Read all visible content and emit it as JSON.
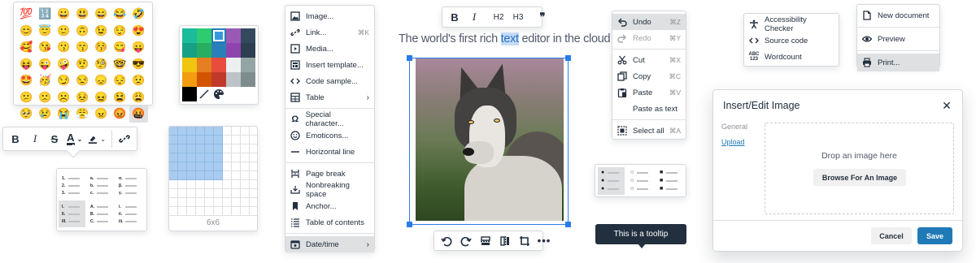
{
  "emoji_panel": {
    "items": [
      "💯",
      "🔢",
      "😀",
      "😃",
      "😄",
      "😂",
      "🤣",
      "😊",
      "😇",
      "🙂",
      "🙃",
      "😉",
      "😌",
      "😍",
      "🥰",
      "😘",
      "😗",
      "😙",
      "😚",
      "😋",
      "😛",
      "😝",
      "😜",
      "🤪",
      "🤨",
      "🧐",
      "🤓",
      "😎",
      "🤩",
      "🥳",
      "😏",
      "😒",
      "😞",
      "😔",
      "😟",
      "😕",
      "🙁",
      "☹️",
      "😣",
      "😖",
      "😫",
      "😩",
      "🥺",
      "😢",
      "😭",
      "😤",
      "😠",
      "😡",
      "🤬"
    ],
    "selected_index": 48
  },
  "color_panel": {
    "colors": [
      "#1abc9c",
      "#2ecc71",
      "#3498db",
      "#9b59b6",
      "#34495e",
      "#16a085",
      "#27ae60",
      "#2980b9",
      "#8e44ad",
      "#2c3e50",
      "#f1c40f",
      "#e67e22",
      "#e74c3c",
      "#ecf0f1",
      "#95a5a6",
      "#f39c12",
      "#d35400",
      "#c0392b",
      "#bdc3c7",
      "#7f8c8d",
      "#000000"
    ],
    "selected_index": 2,
    "tools": [
      "remove-color-icon",
      "color-picker-icon"
    ]
  },
  "format_toolbar": {
    "bold": "B",
    "italic": "I",
    "strike": "S",
    "text_color": "A",
    "highlight": "highlight-icon",
    "link": "link-icon"
  },
  "numbered_list_styles": [
    {
      "marks": [
        "1.",
        "2.",
        "3."
      ]
    },
    {
      "marks": [
        "a.",
        "b.",
        "c."
      ]
    },
    {
      "marks": [
        "α.",
        "β.",
        "γ."
      ]
    },
    {
      "marks": [
        "I.",
        "II.",
        "III."
      ]
    },
    {
      "marks": [
        "A.",
        "B.",
        "C."
      ]
    },
    {
      "marks": [
        "i.",
        "ii.",
        "iii."
      ]
    }
  ],
  "table_picker": {
    "cols_selected": 6,
    "rows_selected": 6,
    "label": "6x6"
  },
  "insert_menu": {
    "items": [
      {
        "label": "Image...",
        "icon": "image-icon",
        "shortcut": ""
      },
      {
        "label": "Link...",
        "icon": "link-icon",
        "shortcut": "⌘K"
      },
      {
        "label": "Media...",
        "icon": "media-icon",
        "shortcut": ""
      },
      {
        "label": "Insert template...",
        "icon": "template-icon",
        "shortcut": ""
      },
      {
        "label": "Code sample...",
        "icon": "code-icon",
        "shortcut": ""
      },
      {
        "label": "Table",
        "icon": "table-icon",
        "shortcut": "",
        "submenu": true
      },
      {
        "label": "Special character...",
        "icon": "omega-icon",
        "shortcut": ""
      },
      {
        "label": "Emoticons...",
        "icon": "emoticon-icon",
        "shortcut": ""
      },
      {
        "label": "Horizontal line",
        "icon": "hr-icon",
        "shortcut": ""
      },
      {
        "label": "Page break",
        "icon": "page-break-icon",
        "shortcut": ""
      },
      {
        "label": "Nonbreaking space",
        "icon": "nbsp-icon",
        "shortcut": ""
      },
      {
        "label": "Anchor...",
        "icon": "bookmark-icon",
        "shortcut": ""
      },
      {
        "label": "Table of contents",
        "icon": "toc-icon",
        "shortcut": ""
      },
      {
        "label": "Date/time",
        "icon": "calendar-icon",
        "shortcut": "",
        "submenu": true
      }
    ]
  },
  "headline": {
    "before": "The world's first rich ",
    "highlight": "text",
    "after": " editor in the cloud"
  },
  "text_toolbar": {
    "bold": "B",
    "italic": "I",
    "h2": "H2",
    "h3": "H3",
    "quote": "❞"
  },
  "image_toolbar": [
    "rotate-left-icon",
    "rotate-right-icon",
    "flip-vertical-icon",
    "flip-horizontal-icon",
    "crop-icon",
    "more-icon"
  ],
  "edit_menu": {
    "items": [
      {
        "label": "Undo",
        "icon": "undo-icon",
        "shortcut": "⌘Z",
        "disabled": false,
        "selected": true
      },
      {
        "label": "Redo",
        "icon": "redo-icon",
        "shortcut": "⌘Y",
        "disabled": true
      },
      {
        "label": "Cut",
        "icon": "cut-icon",
        "shortcut": "⌘X",
        "disabled": false
      },
      {
        "label": "Copy",
        "icon": "copy-icon",
        "shortcut": "⌘C",
        "disabled": false
      },
      {
        "label": "Paste",
        "icon": "paste-icon",
        "shortcut": "⌘V",
        "disabled": false
      },
      {
        "label": "Paste as text",
        "icon": "",
        "shortcut": "",
        "disabled": false
      },
      {
        "label": "Select all",
        "icon": "select-all-icon",
        "shortcut": "⌘A",
        "disabled": false
      }
    ]
  },
  "tools_menu": {
    "items": [
      {
        "label": "Accessibility Checker",
        "icon": "accessibility-icon"
      },
      {
        "label": "Source code",
        "icon": "source-code-icon"
      },
      {
        "label": "Wordcount",
        "icon": "wordcount-icon"
      }
    ]
  },
  "file_menu": {
    "items": [
      {
        "label": "New document",
        "icon": "new-document-icon"
      },
      {
        "label": "Preview",
        "icon": "preview-icon"
      },
      {
        "label": "Print...",
        "icon": "print-icon",
        "selected": true
      }
    ]
  },
  "tooltip": {
    "text": "This is a tooltip"
  },
  "image_dialog": {
    "title": "Insert/Edit Image",
    "tabs": [
      "General",
      "Upload"
    ],
    "active_tab": "Upload",
    "drop_text": "Drop an image here",
    "browse_label": "Browse For An Image",
    "cancel_label": "Cancel",
    "save_label": "Save",
    "accent": "#207ab7"
  }
}
